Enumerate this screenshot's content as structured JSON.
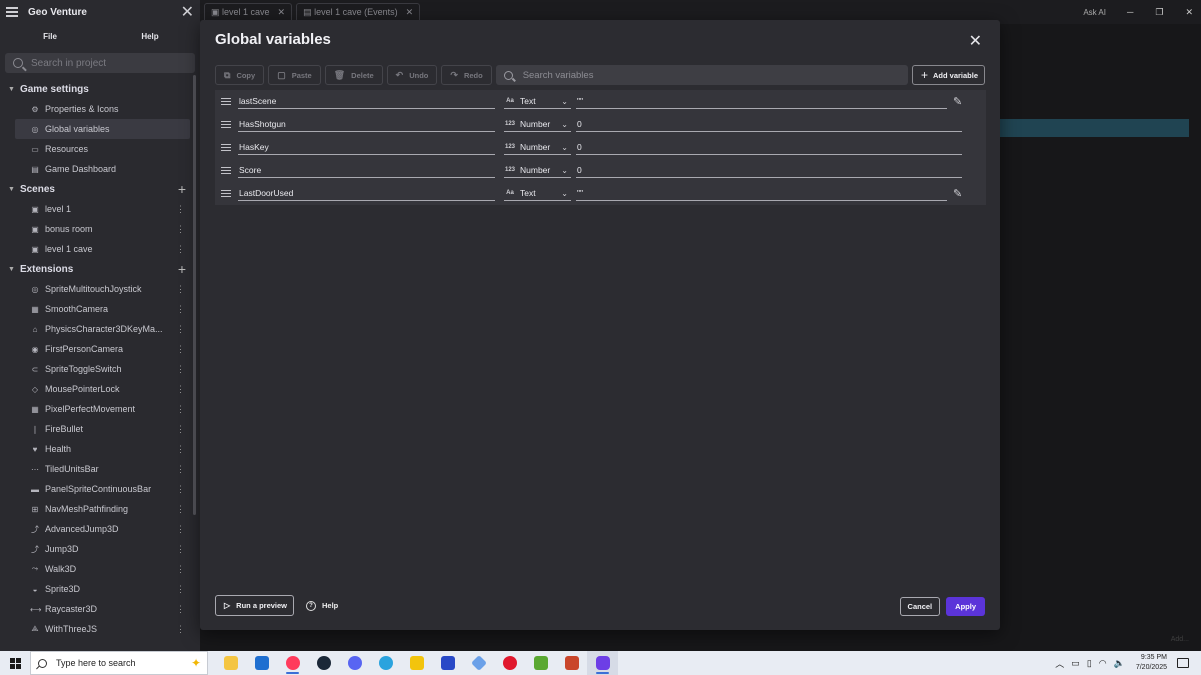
{
  "app": {
    "title": "Geo Venture"
  },
  "sidebar": {
    "tabs": [
      "File",
      "Help"
    ],
    "search_placeholder": "Search in project",
    "game_settings": {
      "label": "Game settings",
      "items": [
        "Properties & Icons",
        "Global variables",
        "Resources",
        "Game Dashboard"
      ]
    },
    "scenes": {
      "label": "Scenes",
      "items": [
        "level 1",
        "bonus room",
        "level 1 cave"
      ]
    },
    "extensions": {
      "label": "Extensions",
      "items": [
        "SpriteMultitouchJoystick",
        "SmoothCamera",
        "PhysicsCharacter3DKeyMa...",
        "FirstPersonCamera",
        "SpriteToggleSwitch",
        "MousePointerLock",
        "PixelPerfectMovement",
        "FireBullet",
        "Health",
        "TiledUnitsBar",
        "PanelSpriteContinuousBar",
        "NavMeshPathfinding",
        "AdvancedJump3D",
        "Jump3D",
        "Walk3D",
        "Sprite3D",
        "Raycaster3D",
        "WithThreeJS"
      ]
    }
  },
  "editor": {
    "tabs": [
      "level 1 cave",
      "level 1 cave (Events)"
    ],
    "ask_ai": "Ask AI",
    "bottom_hint": "Add..."
  },
  "modal": {
    "title": "Global variables",
    "toolbar": {
      "copy": "Copy",
      "paste": "Paste",
      "delete": "Delete",
      "undo": "Undo",
      "redo": "Redo",
      "search_placeholder": "Search variables",
      "add_variable": "Add variable"
    },
    "variables": [
      {
        "name": "lastScene",
        "type_icon": "Aa",
        "type": "Text",
        "value": "\"\""
      },
      {
        "name": "HasShotgun",
        "type_icon": "123",
        "type": "Number",
        "value": "0"
      },
      {
        "name": "HasKey",
        "type_icon": "123",
        "type": "Number",
        "value": "0"
      },
      {
        "name": "Score",
        "type_icon": "123",
        "type": "Number",
        "value": "0"
      },
      {
        "name": "LastDoorUsed",
        "type_icon": "Aa",
        "type": "Text",
        "value": "\"\""
      }
    ],
    "footer": {
      "run_preview": "Run a preview",
      "help": "Help",
      "cancel": "Cancel",
      "apply": "Apply"
    }
  },
  "taskbar": {
    "search_placeholder": "Type here to search",
    "time": "9:35 PM",
    "date": "7/20/2025"
  },
  "colors": {
    "accent": "#5b34d9",
    "modal_bg": "#2c2c31",
    "sidebar_bg": "#2a2a2f"
  }
}
